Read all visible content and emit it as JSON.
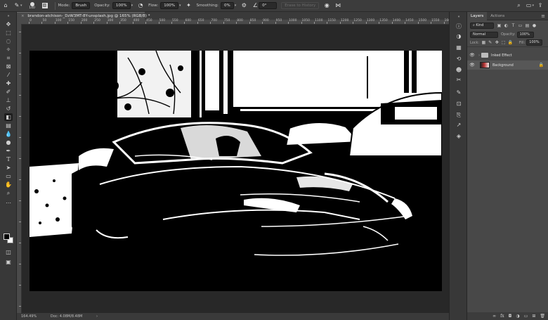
{
  "options_bar": {
    "brush_size": "140",
    "mode_label": "Mode:",
    "mode_value": "Brush",
    "opacity_label": "Opacity:",
    "opacity_value": "100%",
    "flow_label": "Flow:",
    "flow_value": "100%",
    "smoothing_label": "Smoothing:",
    "smoothing_value": "0%",
    "angle_value": "0°",
    "erase_history_label": "Erase to History"
  },
  "document": {
    "tab_title": "brandon-atchison-_DzW3MT-8Y-unsplash.jpg @ 165% (RGB/8) *"
  },
  "ruler": {
    "top_numbers": [
      "0",
      "50",
      "100",
      "150",
      "200",
      "250",
      "300",
      "350",
      "400",
      "450",
      "500",
      "550",
      "600",
      "650",
      "700",
      "750",
      "800",
      "850",
      "900",
      "950",
      "1000",
      "1050",
      "1100",
      "1150",
      "1200",
      "1250",
      "1300",
      "1350",
      "1400",
      "1450",
      "1500",
      "1550",
      "1600"
    ]
  },
  "status_bar": {
    "zoom": "164.49%",
    "doc_info": "Doc: 4.08M/8.48M"
  },
  "layers_panel": {
    "tabs": [
      "Layers",
      "Actions"
    ],
    "kind_label": "Kind",
    "blend_mode": "Normal",
    "opacity_label": "Opacity:",
    "opacity_value": "100%",
    "lock_label": "Lock:",
    "fill_label": "Fill:",
    "fill_value": "100%",
    "layers": [
      {
        "name": "Inked Effect",
        "type": "group"
      },
      {
        "name": "Background",
        "type": "image"
      }
    ]
  },
  "colors": {
    "app_bg": "#535353",
    "panel_bg": "#484848",
    "toolbar_bg": "#383838",
    "canvas_ink": "#000000",
    "canvas_paper": "#ffffff"
  }
}
